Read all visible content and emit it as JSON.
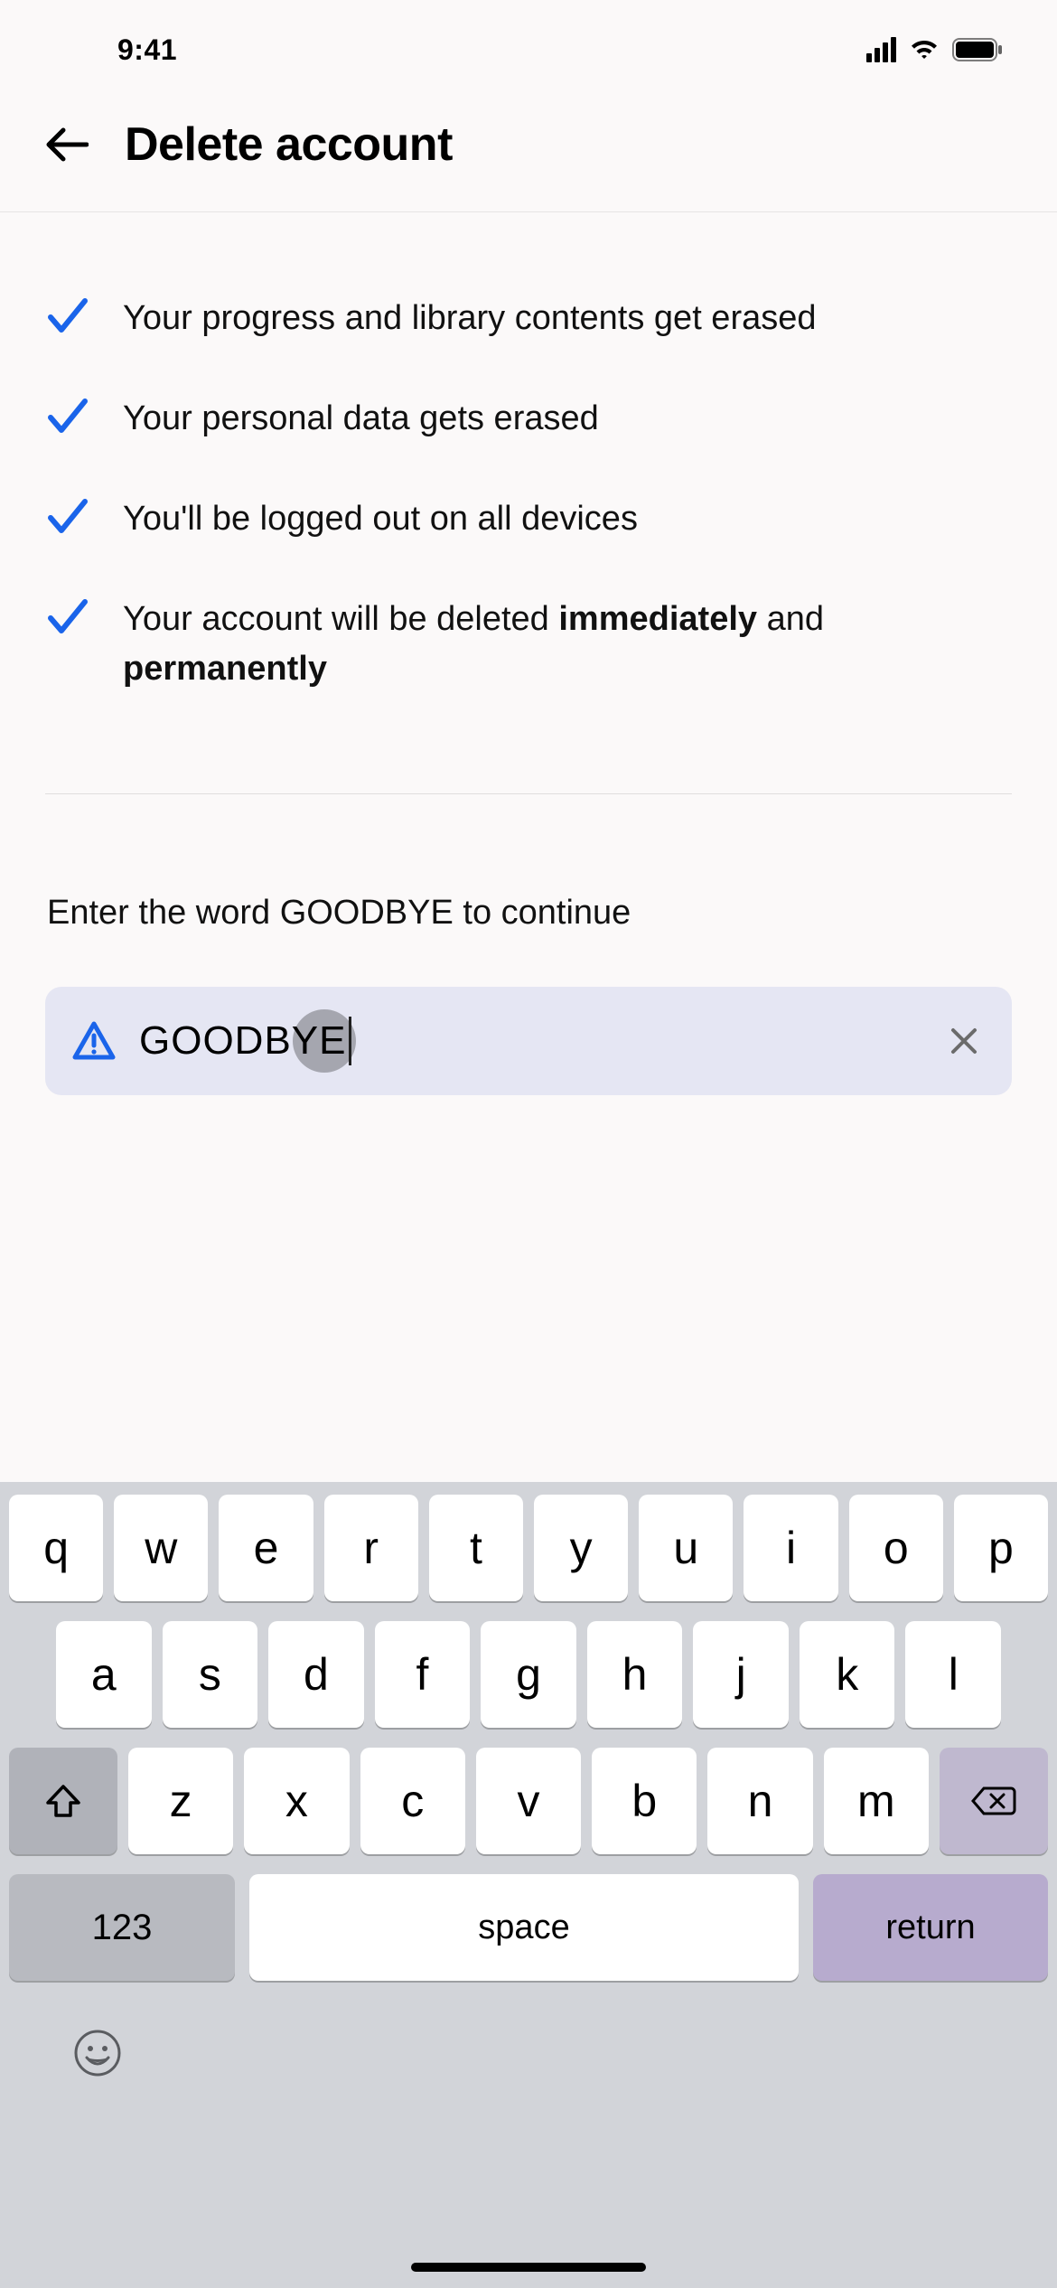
{
  "statusbar": {
    "time": "9:41"
  },
  "header": {
    "title": "Delete account"
  },
  "checklist": [
    {
      "text_html": "Your progress and library contents get erased"
    },
    {
      "text_html": "Your personal data gets erased"
    },
    {
      "text_html": "You'll be logged out on all devices"
    },
    {
      "text_html": "Your account will be deleted <b>immediately</b> and <b>permanently</b>"
    }
  ],
  "input": {
    "prompt": "Enter the word GOODBYE to continue",
    "value": "GOODBYE"
  },
  "keyboard": {
    "row1": [
      "q",
      "w",
      "e",
      "r",
      "t",
      "y",
      "u",
      "i",
      "o",
      "p"
    ],
    "row2": [
      "a",
      "s",
      "d",
      "f",
      "g",
      "h",
      "j",
      "k",
      "l"
    ],
    "row3": [
      "z",
      "x",
      "c",
      "v",
      "b",
      "n",
      "m"
    ],
    "num_label": "123",
    "space_label": "space",
    "return_label": "return"
  },
  "colors": {
    "check_blue": "#1a64ea",
    "input_bg": "#e5e6f3"
  }
}
